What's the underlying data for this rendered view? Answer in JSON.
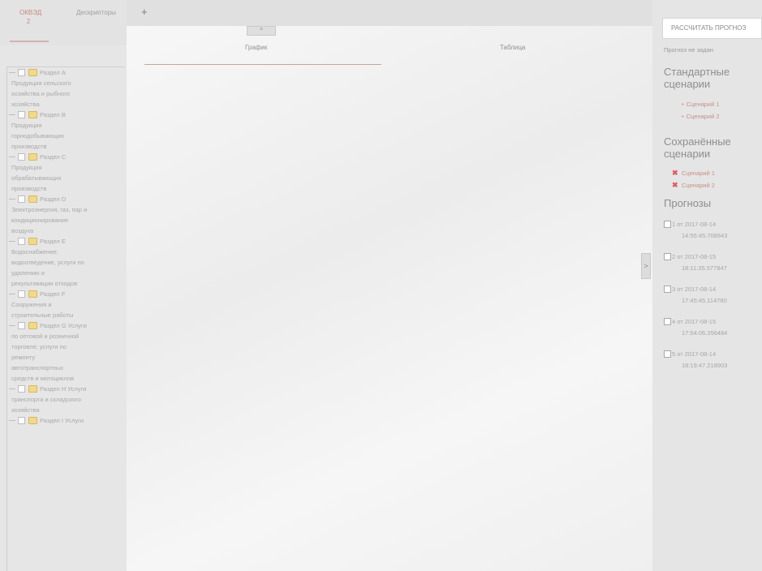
{
  "left_tabs": {
    "tab1_line1": "ОКВЭД",
    "tab1_line2": "2",
    "tab2": "Дескрипторы"
  },
  "tree": [
    {
      "name": "Раздел А",
      "lines": [
        "Продукция сельского",
        "хозяйства и рыбного",
        "хозяйства"
      ]
    },
    {
      "name": "Раздел В",
      "lines": [
        "Продукция",
        "горнодобывающих",
        "производств"
      ]
    },
    {
      "name": "Раздел С",
      "lines": [
        "Продукция",
        "обрабатывающих",
        "производств"
      ]
    },
    {
      "name": "Раздел D",
      "lines": [
        "Электроэнергия, газ, пар и",
        "кондиционирование",
        "воздуха"
      ]
    },
    {
      "name": "Раздел Е",
      "lines": [
        "Водоснабжение;",
        "водоотведение, услуги по",
        "удалению и",
        "рекультивации отходов"
      ]
    },
    {
      "name": "Раздел F",
      "lines": [
        "Сооружения и",
        "строительные работы"
      ]
    },
    {
      "name": "Раздел G Услуги",
      "lines": [
        "по оптовой и розничной",
        "торговле; услуги по",
        "ремонту",
        "автотранспортных",
        "средств и мотоциклов"
      ]
    },
    {
      "name": "Раздел Н Услуги",
      "lines": [
        "транспорта и складского",
        "хозяйства"
      ]
    },
    {
      "name": "Раздел I Услуги",
      "lines": []
    }
  ],
  "top": {
    "add_tab": "+",
    "collapse_top": "^"
  },
  "view_tabs": {
    "graph": "График",
    "table": "Таблица"
  },
  "collapse": {
    "left": "<",
    "right": ">"
  },
  "right_panel": {
    "calc_button": "РАССЧИТАТЬ ПРОГНОЗ",
    "forecast_for": "Прогноз не задан",
    "std_heading": "Стандартные сценарии",
    "std_items": [
      "Сценарий 1",
      "Сценарий 2"
    ],
    "saved_heading": "Сохранённые сценарии",
    "saved_items": [
      "Сценарий 1",
      "Сценарий 2"
    ],
    "forecasts_heading": "Прогнозы",
    "forecasts": [
      {
        "line1": "1 от 2017-08-14",
        "line2": "14:55:45.708943"
      },
      {
        "line1": "2 от 2017-08-15",
        "line2": "18:11:35.577847"
      },
      {
        "line1": "3 от 2017-08-14",
        "line2": "17:45:45.114780"
      },
      {
        "line1": "4 от 2017-08-15",
        "line2": "17:54:06.356484"
      },
      {
        "line1": "5 от 2017-08-14",
        "line2": "18:19:47.218903"
      }
    ]
  },
  "colors": {
    "accent": "#c89088",
    "delete": "#e05b5b",
    "sidebar_bg": "#e6e6e6"
  }
}
